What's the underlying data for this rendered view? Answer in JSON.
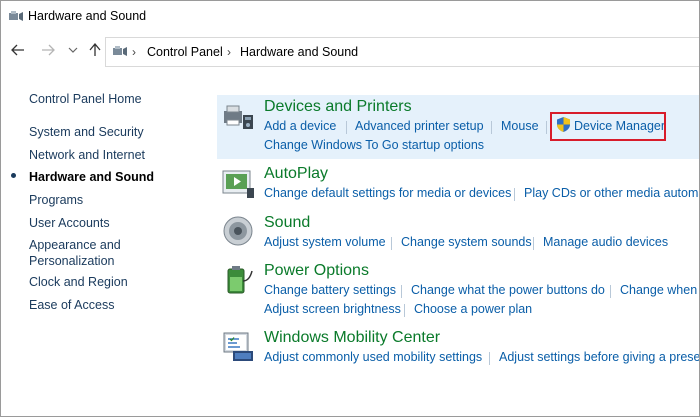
{
  "window": {
    "title": "Hardware and Sound"
  },
  "nav": {
    "breadcrumb": [
      "Control Panel",
      "Hardware and Sound"
    ]
  },
  "sidebar": {
    "items": [
      {
        "label": "Control Panel Home"
      },
      {
        "label": "System and Security"
      },
      {
        "label": "Network and Internet"
      },
      {
        "label": "Hardware and Sound",
        "active": true
      },
      {
        "label": "Programs"
      },
      {
        "label": "User Accounts"
      },
      {
        "label": "Appearance and Personalization"
      },
      {
        "label": "Clock and Region"
      },
      {
        "label": "Ease of Access"
      }
    ]
  },
  "categories": {
    "devices": {
      "title": "Devices and Printers",
      "links": [
        "Add a device",
        "Advanced printer setup",
        "Mouse",
        "Device Manager",
        "Change Windows To Go startup options"
      ]
    },
    "autoplay": {
      "title": "AutoPlay",
      "links": [
        "Change default settings for media or devices",
        "Play CDs or other media automatically"
      ]
    },
    "sound": {
      "title": "Sound",
      "links": [
        "Adjust system volume",
        "Change system sounds",
        "Manage audio devices"
      ]
    },
    "power": {
      "title": "Power Options",
      "links": [
        "Change battery settings",
        "Change what the power buttons do",
        "Change when the computer sleeps",
        "Adjust screen brightness",
        "Choose a power plan"
      ]
    },
    "mobility": {
      "title": "Windows Mobility Center",
      "links": [
        "Adjust commonly used mobility settings",
        "Adjust settings before giving a presentation"
      ]
    }
  },
  "colors": {
    "link": "#0a5ea8",
    "title": "#0a7a2a",
    "highlight": "#e5f1fb",
    "callout": "#d81c2a"
  }
}
